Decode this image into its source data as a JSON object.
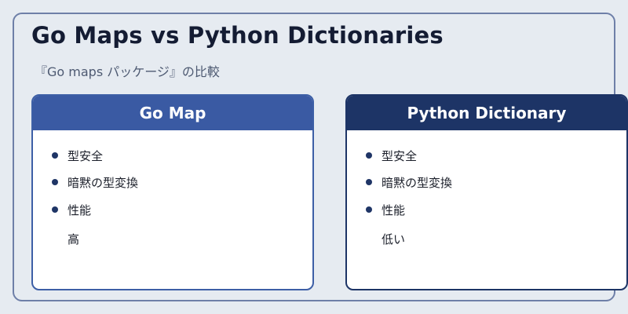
{
  "header": {
    "title": "Go Maps vs Python Dictionaries",
    "subtitle": "『Go maps パッケージ』の比較"
  },
  "cards": [
    {
      "title": "Go Map",
      "items": [
        "型安全",
        "暗黙の型変換",
        "性能"
      ],
      "overflow": "高"
    },
    {
      "title": "Python Dictionary",
      "items": [
        "型安全",
        "暗黙の型変換",
        "性能"
      ],
      "overflow": "低い"
    }
  ],
  "colors": {
    "background": "#e6ebf1",
    "frame_border": "#6e7fa8",
    "go_header": "#3a5aa3",
    "python_header": "#1d3466",
    "title_text": "#141c33",
    "bullet": "#1f3566"
  }
}
